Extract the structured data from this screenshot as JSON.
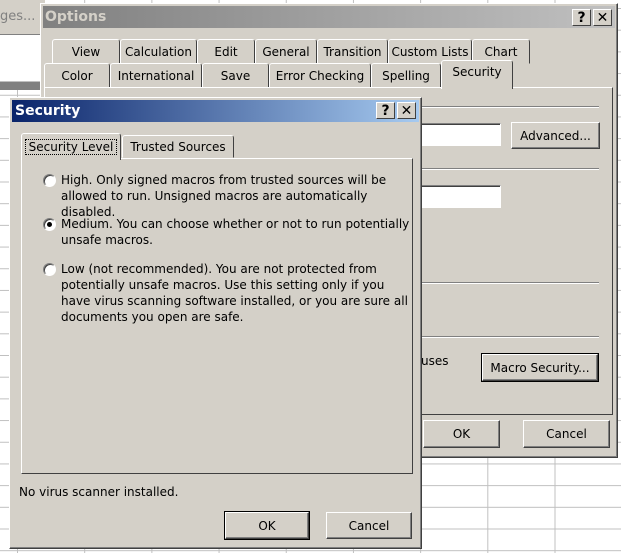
{
  "background": {
    "toolbar_fragment": "ges... |"
  },
  "options_dialog": {
    "title": "Options",
    "help_label": "?",
    "close_label": "✕",
    "tabs_row1": [
      "View",
      "Calculation",
      "Edit",
      "General",
      "Transition",
      "Custom Lists",
      "Chart"
    ],
    "tabs_row2": [
      "Color",
      "International",
      "Save",
      "Error Checking",
      "Spelling",
      "Security"
    ],
    "active_tab": "Security",
    "advanced_button": "Advanced...",
    "partial_text": "uses",
    "macro_security_button": "Macro Security...",
    "ok": "OK",
    "cancel": "Cancel"
  },
  "security_dialog": {
    "title": "Security",
    "help_label": "?",
    "close_label": "✕",
    "tabs": [
      "Security Level",
      "Trusted Sources"
    ],
    "active_tab": "Security Level",
    "options": [
      {
        "label": "High. Only signed macros from trusted sources will be allowed to run. Unsigned macros are automatically disabled.",
        "selected": false
      },
      {
        "label": "Medium. You can choose whether or not to run potentially unsafe macros.",
        "selected": true
      },
      {
        "label": "Low (not recommended). You are not protected from potentially unsafe macros. Use this setting only if you have virus scanning software installed, or you are sure all documents you open are safe.",
        "selected": false
      }
    ],
    "status": "No virus scanner installed.",
    "ok": "OK",
    "cancel": "Cancel"
  },
  "colors": {
    "dialog_bg": "#d4d0c8",
    "active_title_start": "#0a246a",
    "active_title_end": "#a6caf0",
    "inactive_title_start": "#808080",
    "inactive_title_end": "#c0c0c0"
  }
}
